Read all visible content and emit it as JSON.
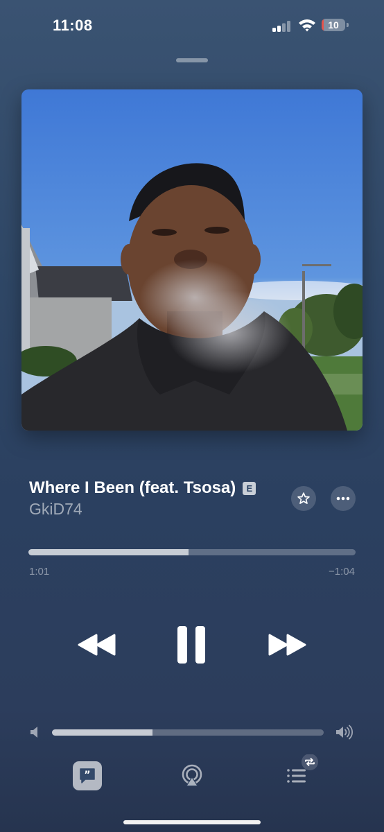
{
  "status_bar": {
    "time": "11:08",
    "battery_level": "10",
    "battery_fraction": 0.1
  },
  "track": {
    "title": "Where I Been (feat. Tsosa)",
    "explicit_badge": "E",
    "artist": "GkiD74"
  },
  "playback": {
    "elapsed": "1:01",
    "remaining": "−1:04",
    "progress_fraction": 0.49,
    "volume_fraction": 0.37,
    "state": "playing"
  },
  "icons": {
    "favorite": "star-icon",
    "more": "ellipsis-icon",
    "rewind": "rewind-icon",
    "pause": "pause-icon",
    "forward": "fast-forward-icon",
    "volume_low": "speaker-low-icon",
    "volume_high": "speaker-high-icon",
    "lyrics": "lyrics-quote-icon",
    "airplay": "airplay-icon",
    "queue": "queue-list-icon"
  },
  "colors": {
    "battery_low": "#e5534b",
    "sky": "#4f86d6"
  }
}
